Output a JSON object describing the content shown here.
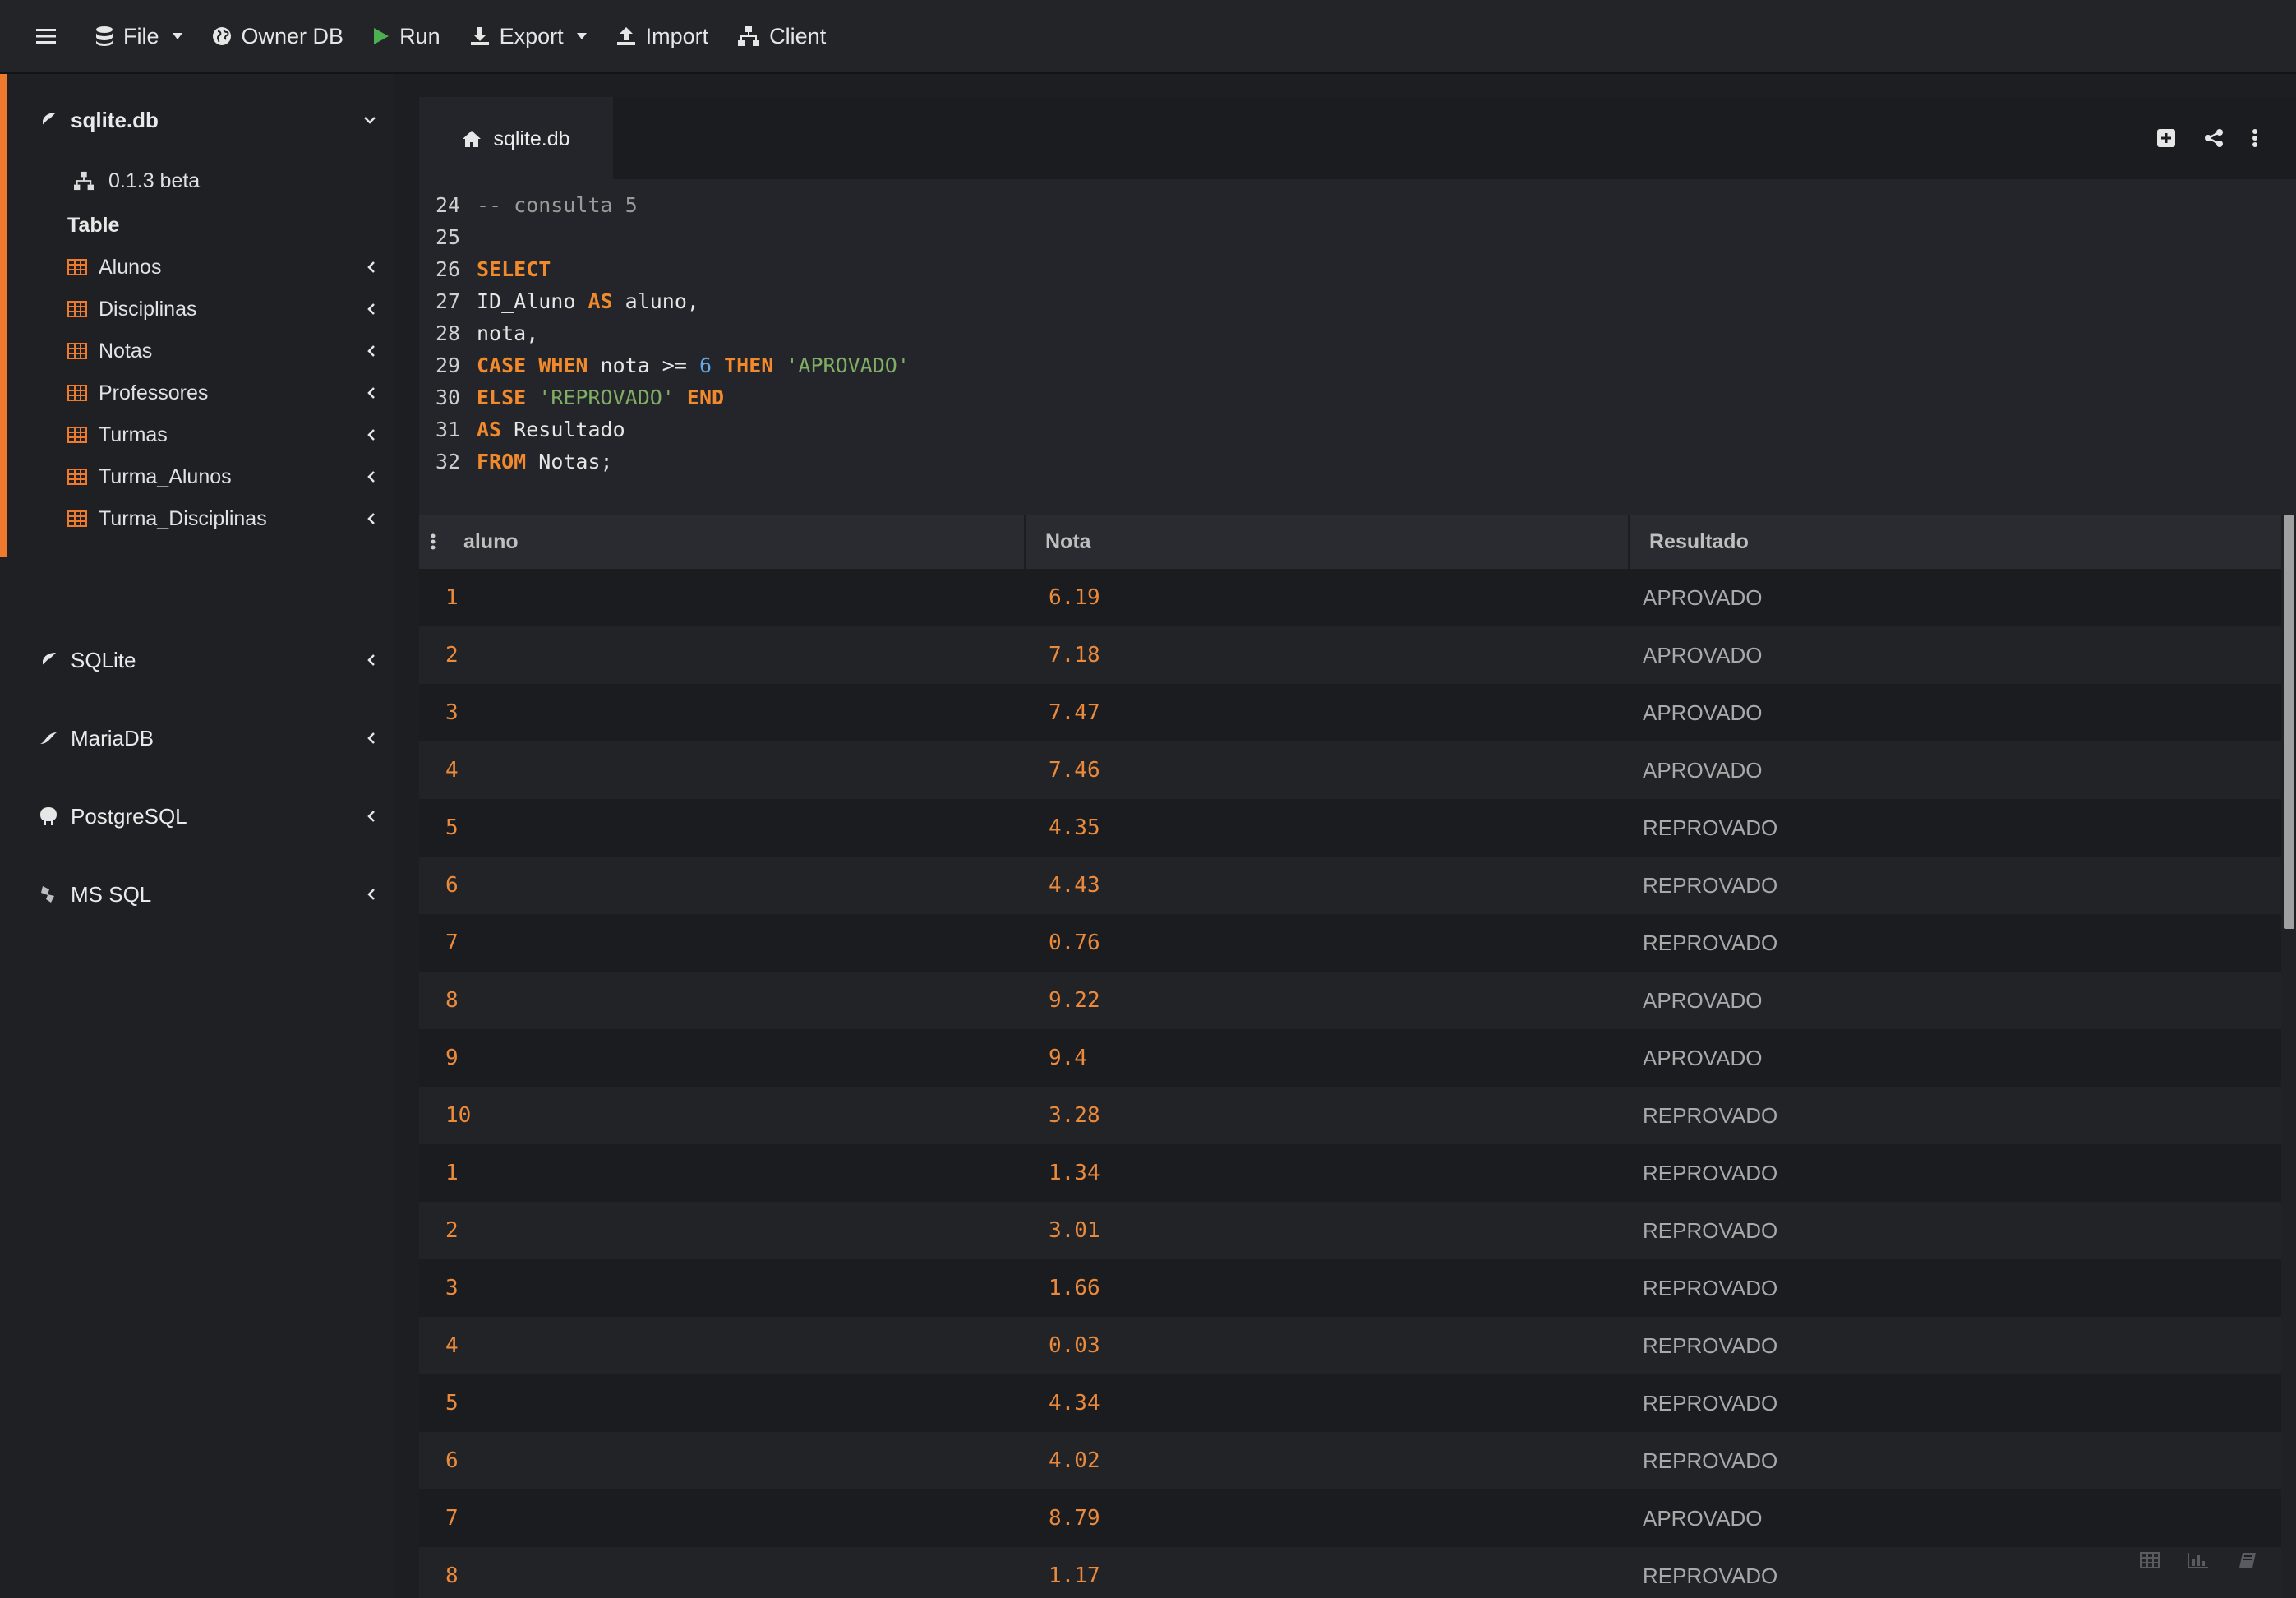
{
  "toolbar": {
    "file": "File",
    "owner_db": "Owner DB",
    "run": "Run",
    "export": "Export",
    "import": "Import",
    "client": "Client"
  },
  "sidebar": {
    "db_name": "sqlite.db",
    "version": "0.1.3 beta",
    "tables_heading": "Table",
    "tables": [
      "Alunos",
      "Disciplinas",
      "Notas",
      "Professores",
      "Turmas",
      "Turma_Alunos",
      "Turma_Disciplinas"
    ],
    "other_dbs": [
      "SQLite",
      "MariaDB",
      "PostgreSQL",
      "MS SQL"
    ]
  },
  "tab": {
    "label": "sqlite.db"
  },
  "editor": {
    "lines": [
      {
        "n": "24",
        "t": "-- consulta 5"
      },
      {
        "n": "25",
        "t": ""
      },
      {
        "n": "26",
        "t": "SELECT"
      },
      {
        "n": "27",
        "t": "ID_Aluno AS aluno,"
      },
      {
        "n": "28",
        "t": "nota,"
      },
      {
        "n": "29",
        "t": "CASE WHEN nota >= 6 THEN 'APROVADO'"
      },
      {
        "n": "30",
        "t": "ELSE 'REPROVADO' END"
      },
      {
        "n": "31",
        "t": "AS Resultado"
      },
      {
        "n": "32",
        "t": "FROM Notas;"
      }
    ]
  },
  "results": {
    "columns": [
      "aluno",
      "Nota",
      "Resultado"
    ],
    "rows": [
      [
        "1",
        "6.19",
        "APROVADO"
      ],
      [
        "2",
        "7.18",
        "APROVADO"
      ],
      [
        "3",
        "7.47",
        "APROVADO"
      ],
      [
        "4",
        "7.46",
        "APROVADO"
      ],
      [
        "5",
        "4.35",
        "REPROVADO"
      ],
      [
        "6",
        "4.43",
        "REPROVADO"
      ],
      [
        "7",
        "0.76",
        "REPROVADO"
      ],
      [
        "8",
        "9.22",
        "APROVADO"
      ],
      [
        "9",
        "9.4",
        "APROVADO"
      ],
      [
        "10",
        "3.28",
        "REPROVADO"
      ],
      [
        "1",
        "1.34",
        "REPROVADO"
      ],
      [
        "2",
        "3.01",
        "REPROVADO"
      ],
      [
        "3",
        "1.66",
        "REPROVADO"
      ],
      [
        "4",
        "0.03",
        "REPROVADO"
      ],
      [
        "5",
        "4.34",
        "REPROVADO"
      ],
      [
        "6",
        "4.02",
        "REPROVADO"
      ],
      [
        "7",
        "8.79",
        "APROVADO"
      ],
      [
        "8",
        "1.17",
        "REPROVADO"
      ]
    ]
  },
  "colors": {
    "accent": "#ed7a2d",
    "keyword": "#f08a2c",
    "string": "#7fae64",
    "number": "#63a8e8",
    "run_icon": "#4caf50"
  }
}
